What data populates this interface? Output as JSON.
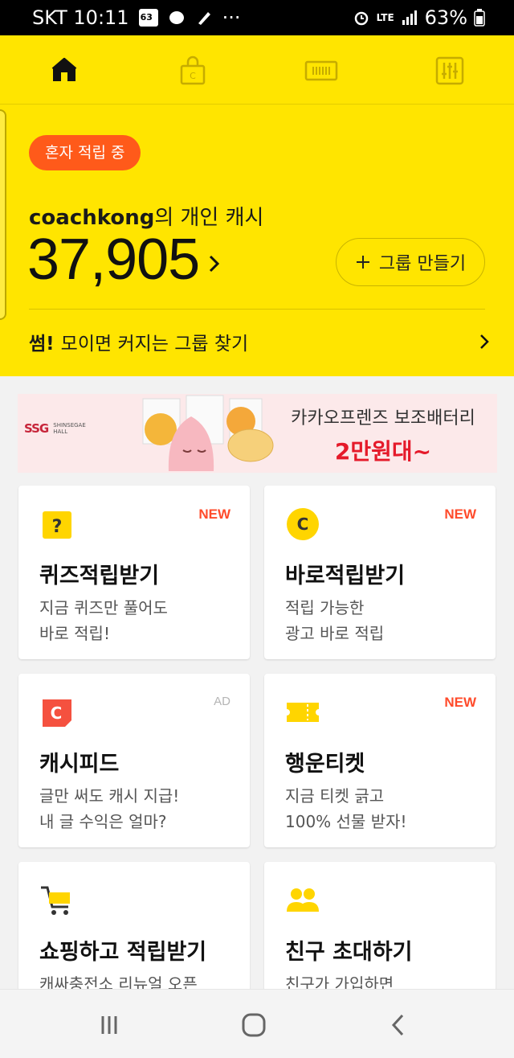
{
  "status_bar": {
    "carrier_time": "SKT 10:11",
    "notif_count": "63",
    "dots": "···",
    "network": "LTE",
    "battery": "63%"
  },
  "colors": {
    "brand_yellow": "#ffe500",
    "accent_orange": "#ff5a1a",
    "new_badge": "#ff4b2b",
    "sale_red": "#e51a2a"
  },
  "top_nav": {
    "items": [
      {
        "icon": "home-icon",
        "active": true
      },
      {
        "icon": "shopping-bag-icon",
        "active": false
      },
      {
        "icon": "ticket-barcode-icon",
        "active": false
      },
      {
        "icon": "settings-sliders-icon",
        "active": false
      }
    ]
  },
  "hero": {
    "status_pill": "혼자 적립 중",
    "owner_name": "coachkong",
    "owner_suffix": "의 개인 캐시",
    "balance": "37,905",
    "group_button": "그룹 만들기",
    "find_prefix": "썸!",
    "find_text": "모이면 커지는 그룹 찾기"
  },
  "banner": {
    "logo_mark": "SSG",
    "logo_text": "SHINSEGAE HALL",
    "line1": "카카오프렌즈 보조배터리",
    "line2": "2만원대~"
  },
  "cards": [
    {
      "title": "퀴즈적립받기",
      "desc": "지금 퀴즈만 풀어도\n바로 적립!",
      "badge": "NEW",
      "icon": "quiz-question-icon"
    },
    {
      "title": "바로적립받기",
      "desc": "적립 가능한\n광고 바로 적립",
      "badge": "NEW",
      "icon": "coin-c-icon"
    },
    {
      "title": "캐시피드",
      "desc": "글만 써도 캐시 지급!\n내 글 수익은 얼마?",
      "badge": "AD",
      "icon": "cashfeed-icon"
    },
    {
      "title": "행운티켓",
      "desc": "지금 티켓 긁고\n100% 선물 받자!",
      "badge": "NEW",
      "icon": "lucky-ticket-icon"
    },
    {
      "title": "쇼핑하고 적립받기",
      "desc": "캐싸충전소 리뉴얼 오픈",
      "badge": "",
      "icon": "shopping-cart-icon"
    },
    {
      "title": "친구 초대하기",
      "desc": "친구가 가입하면",
      "badge": "",
      "icon": "friends-icon"
    }
  ]
}
